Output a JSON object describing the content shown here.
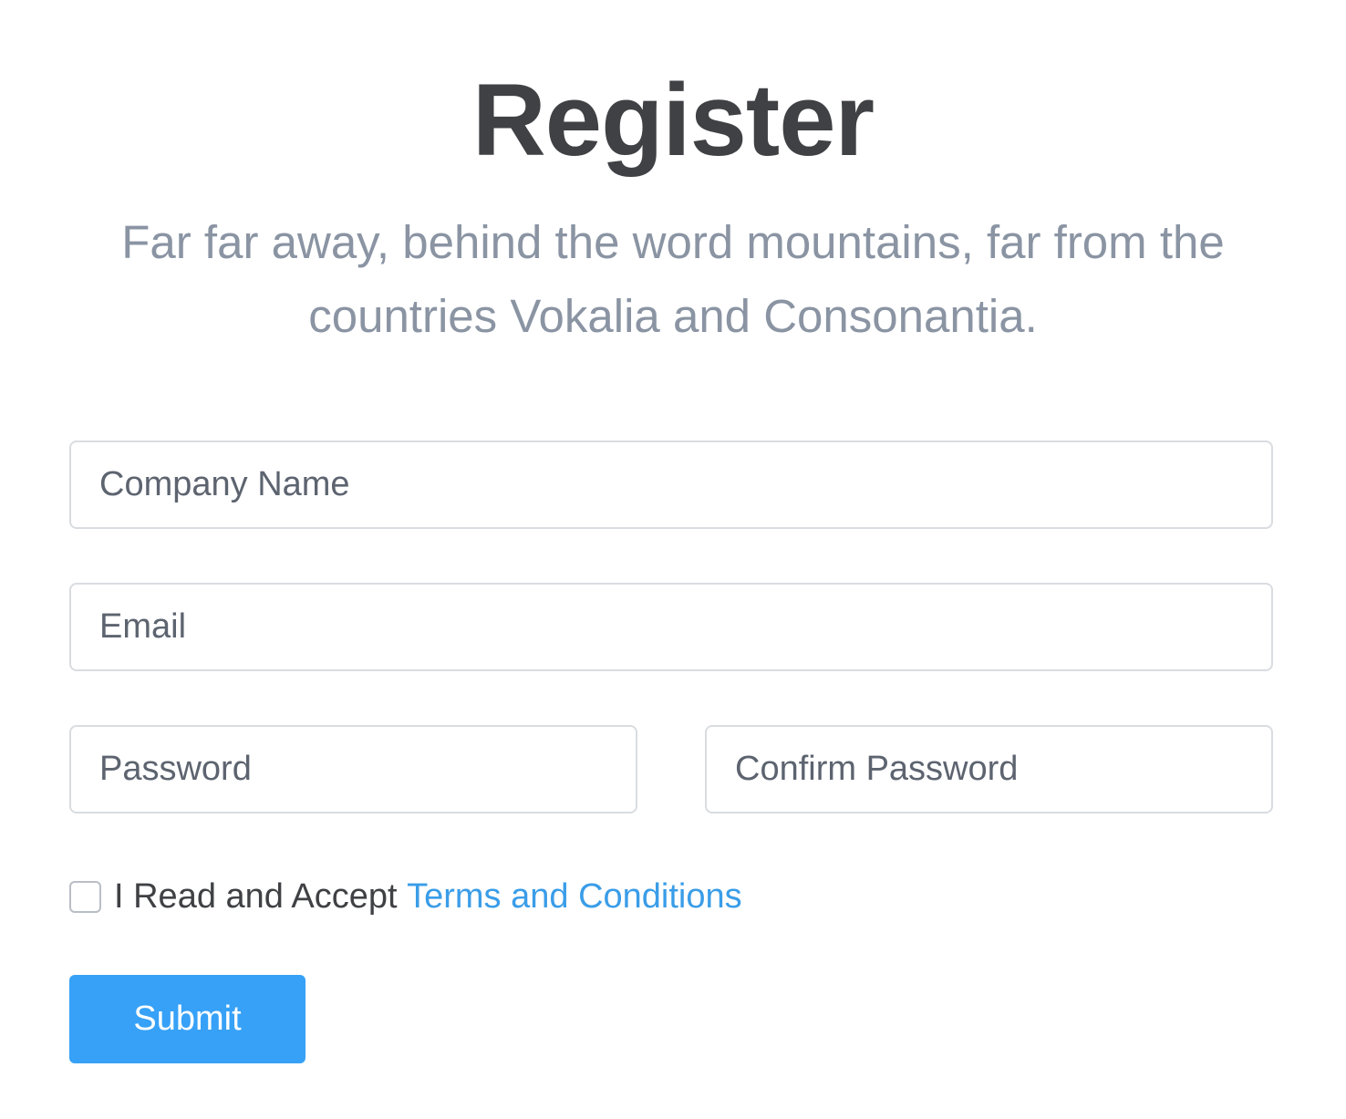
{
  "header": {
    "title": "Register",
    "subtitle": "Far far away, behind the word mountains, far from the countries Vokalia and Consonantia."
  },
  "form": {
    "company_placeholder": "Company Name",
    "email_placeholder": "Email",
    "password_placeholder": "Password",
    "confirm_password_placeholder": "Confirm Password",
    "terms_prefix": "I Read and Accept ",
    "terms_link": "Terms and Conditions",
    "terms_checked": false,
    "submit_label": "Submit"
  },
  "colors": {
    "accent": "#36a1f7",
    "link": "#3a9de8",
    "title": "#3f4144",
    "subtitle": "#8a94a3"
  }
}
